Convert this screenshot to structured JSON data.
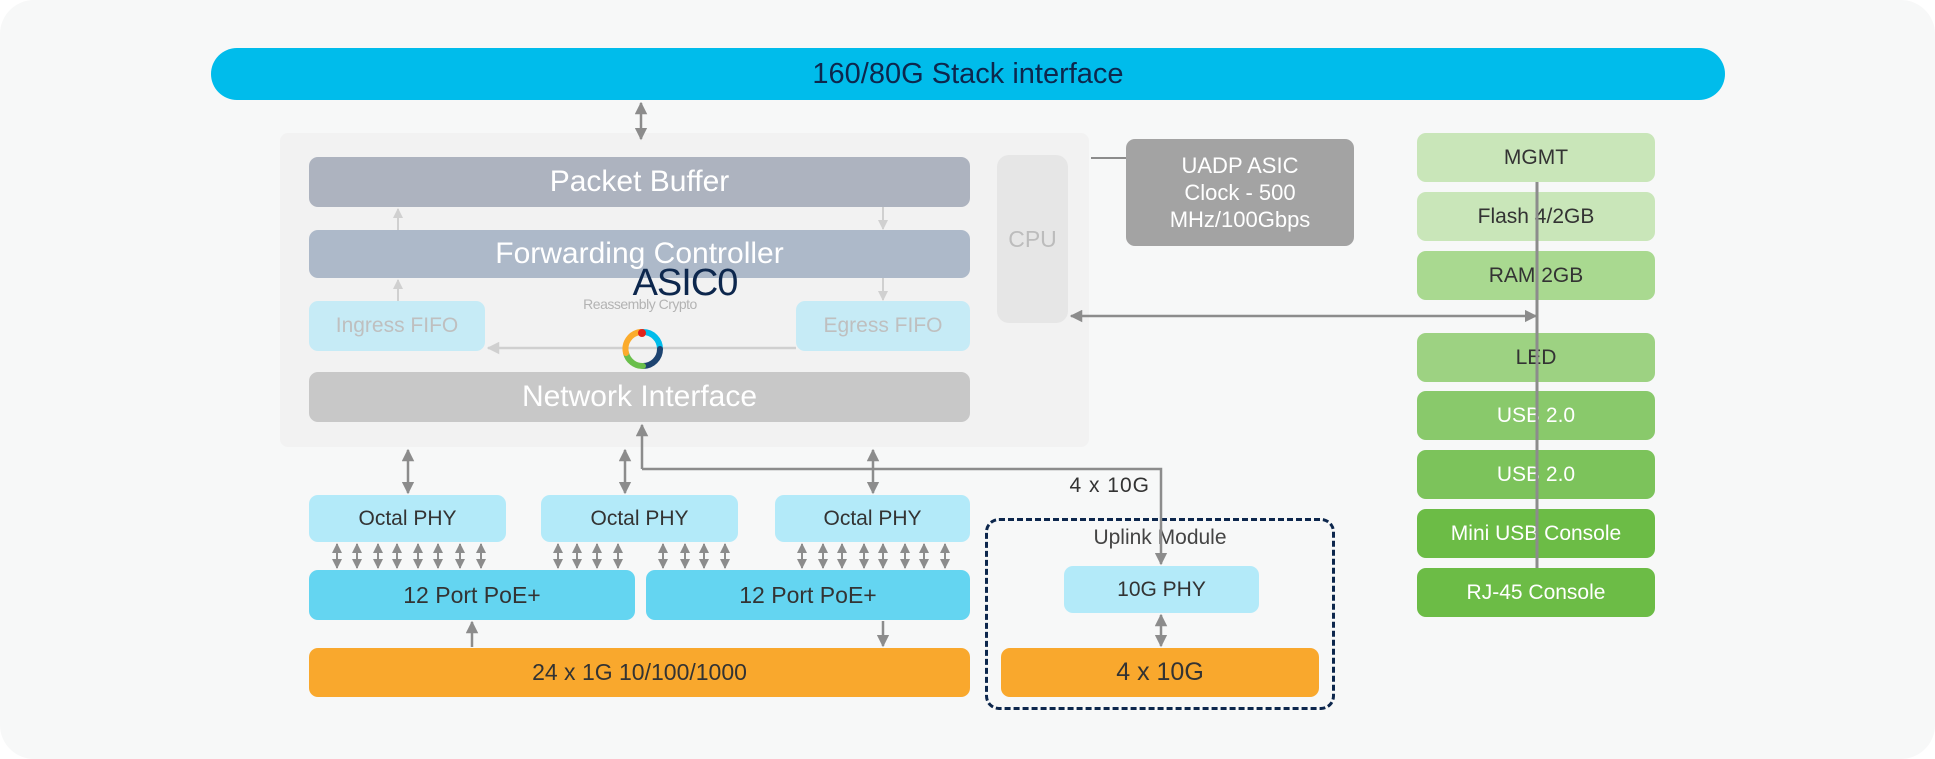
{
  "diagram": {
    "stack_interface": "160/80G Stack interface",
    "asic": {
      "label": "ASIC0",
      "sublabel": "Reassembly  Crypto",
      "packet_buffer": "Packet Buffer",
      "forwarding_controller": "Forwarding Controller",
      "ingress_fifo": "Ingress FIFO",
      "egress_fifo": "Egress FIFO",
      "network_interface": "Network Interface",
      "cpu": "CPU",
      "icon": "sync-cycle-icon"
    },
    "uadp": {
      "line1": "UADP ASIC",
      "line2": "Clock - 500",
      "line3": "MHz/100Gbps"
    },
    "peripherals": [
      {
        "label": "MGMT"
      },
      {
        "label": "Flash 4/2GB"
      },
      {
        "label": "RAM 2GB"
      },
      {
        "label": "LED"
      },
      {
        "label": "USB 2.0"
      },
      {
        "label": "USB 2.0"
      },
      {
        "label": "Mini USB Console"
      },
      {
        "label": "RJ-45 Console"
      }
    ],
    "phys": [
      {
        "label": "Octal PHY"
      },
      {
        "label": "Octal PHY"
      },
      {
        "label": "Octal PHY"
      }
    ],
    "poe": [
      {
        "label": "12 Port PoE+"
      },
      {
        "label": "12 Port PoE+"
      }
    ],
    "ports_1g": "24 x 1G 10/100/1000",
    "uplink_link_label": "4 x 10G",
    "uplink_module": {
      "title": "Uplink Module",
      "phy": "10G PHY",
      "ports": "4 x 10G"
    },
    "colors": {
      "stack": "#00bceb",
      "asic_title": "#0d274d",
      "ports": "#f9a82d",
      "poe": "#64d5f1",
      "phy": "#b3eaf9",
      "uadp": "#a3a3a3",
      "connector": "#8c8c8c"
    }
  }
}
